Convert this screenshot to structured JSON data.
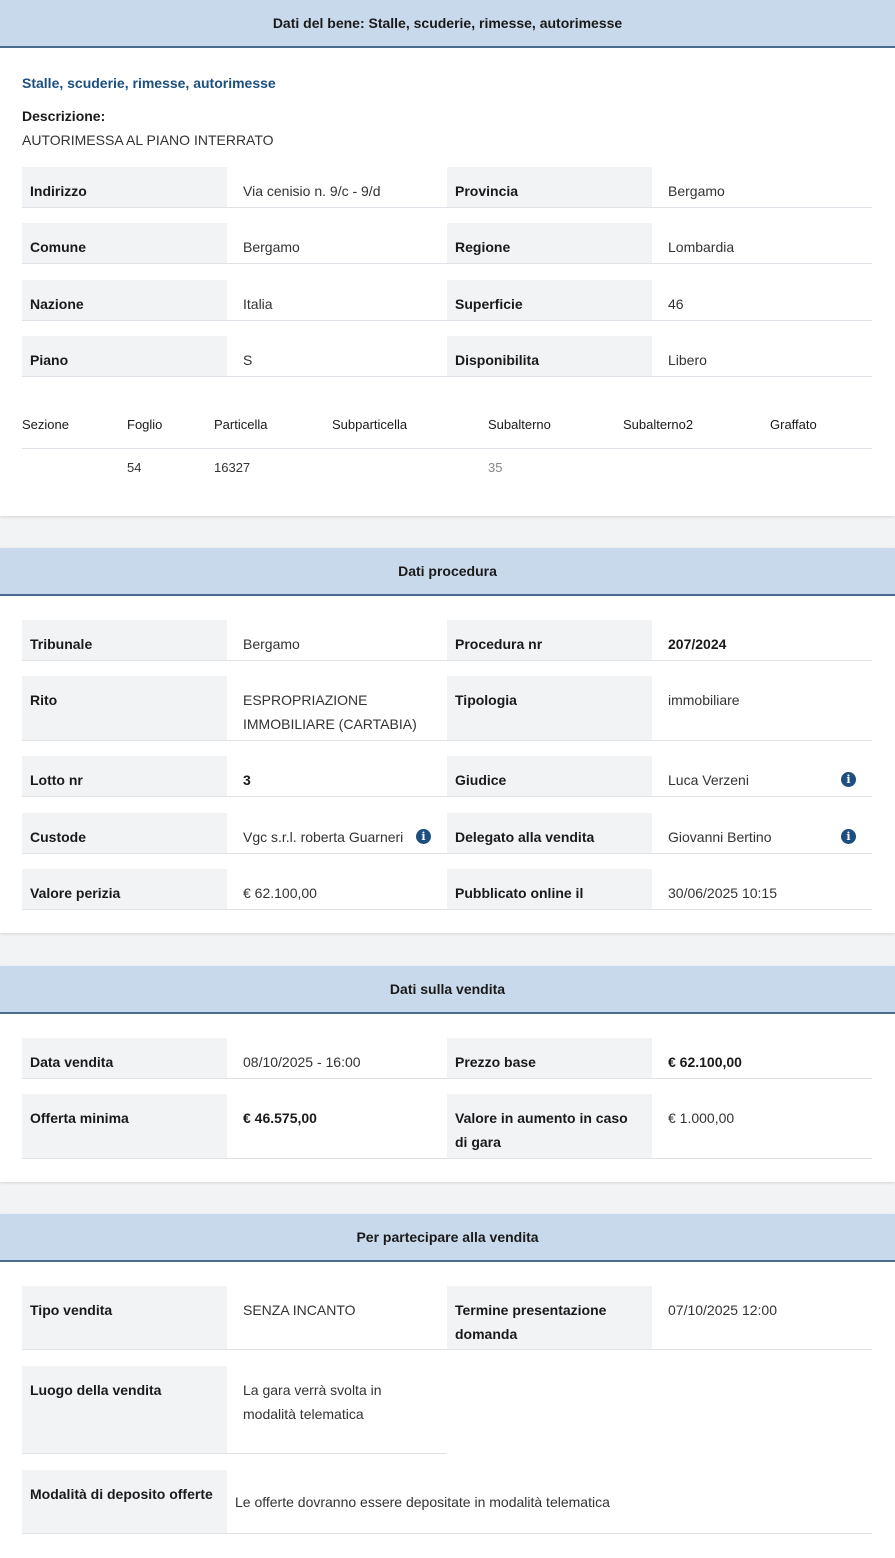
{
  "bene": {
    "header": "Dati del bene: Stalle, scuderie, rimesse, autorimesse",
    "subtitle": "Stalle, scuderie, rimesse, autorimesse",
    "descrizione_label": "Descrizione:",
    "descrizione": "AUTORIMESSA AL PIANO INTERRATO",
    "rows": [
      {
        "l1": "Indirizzo",
        "v1": "Via cenisio n. 9/c - 9/d",
        "l2": "Provincia",
        "v2": "Bergamo"
      },
      {
        "l1": "Comune",
        "v1": "Bergamo",
        "l2": "Regione",
        "v2": "Lombardia"
      },
      {
        "l1": "Nazione",
        "v1": "Italia",
        "l2": "Superficie",
        "v2": "46"
      },
      {
        "l1": "Piano",
        "v1": "S",
        "l2": "Disponibilita",
        "v2": "Libero"
      }
    ],
    "catasto": {
      "headers": [
        "Sezione",
        "Foglio",
        "Particella",
        "Subparticella",
        "Subalterno",
        "Subalterno2",
        "Graffato"
      ],
      "values": [
        "",
        "54",
        "16327",
        "",
        "35",
        "",
        ""
      ]
    }
  },
  "procedura": {
    "header": "Dati procedura",
    "rows": [
      {
        "l1": "Tribunale",
        "v1": "Bergamo",
        "l2": "Procedura nr",
        "v2": "207/2024"
      },
      {
        "l1": "Rito",
        "v1": "ESPROPRIAZIONE IMMOBILIARE (CARTABIA)",
        "l2": "Tipologia",
        "v2": "immobiliare"
      },
      {
        "l1": "Lotto nr",
        "v1": "3",
        "l2": "Giudice",
        "v2": "Luca Verzeni"
      },
      {
        "l1": "Custode",
        "v1": "Vgc s.r.l. roberta Guarneri",
        "l2": "Delegato alla vendita",
        "v2": "Giovanni Bertino"
      },
      {
        "l1": "Valore perizia",
        "v1": "€ 62.100,00",
        "l2": "Pubblicato online il",
        "v2": "30/06/2025 10:15"
      }
    ]
  },
  "vendita": {
    "header": "Dati sulla vendita",
    "rows": [
      {
        "l1": "Data vendita",
        "v1": "08/10/2025 - 16:00",
        "l2": "Prezzo base",
        "v2": "€ 62.100,00"
      },
      {
        "l1": "Offerta minima",
        "v1": "€ 46.575,00",
        "l2": "Valore in aumento in caso di gara",
        "v2": "€ 1.000,00"
      }
    ]
  },
  "partecipare": {
    "header": "Per partecipare alla vendita",
    "tipo_label": "Tipo vendita",
    "tipo_value": "SENZA INCANTO",
    "termine_label": "Termine presentazione domanda",
    "termine_value": "07/10/2025 12:00",
    "luogo_label": "Luogo della vendita",
    "luogo_value": "La gara verrà svolta in modalità telematica",
    "deposito_label": "Modalità di deposito offerte",
    "deposito_value": "Le offerte dovranno essere depositate in modalità telematica"
  },
  "icons": {
    "info": "info-icon"
  },
  "colors": {
    "header_bg": "#c8d9ec",
    "accent": "#1c4f80",
    "label_bg": "#f2f3f5"
  }
}
